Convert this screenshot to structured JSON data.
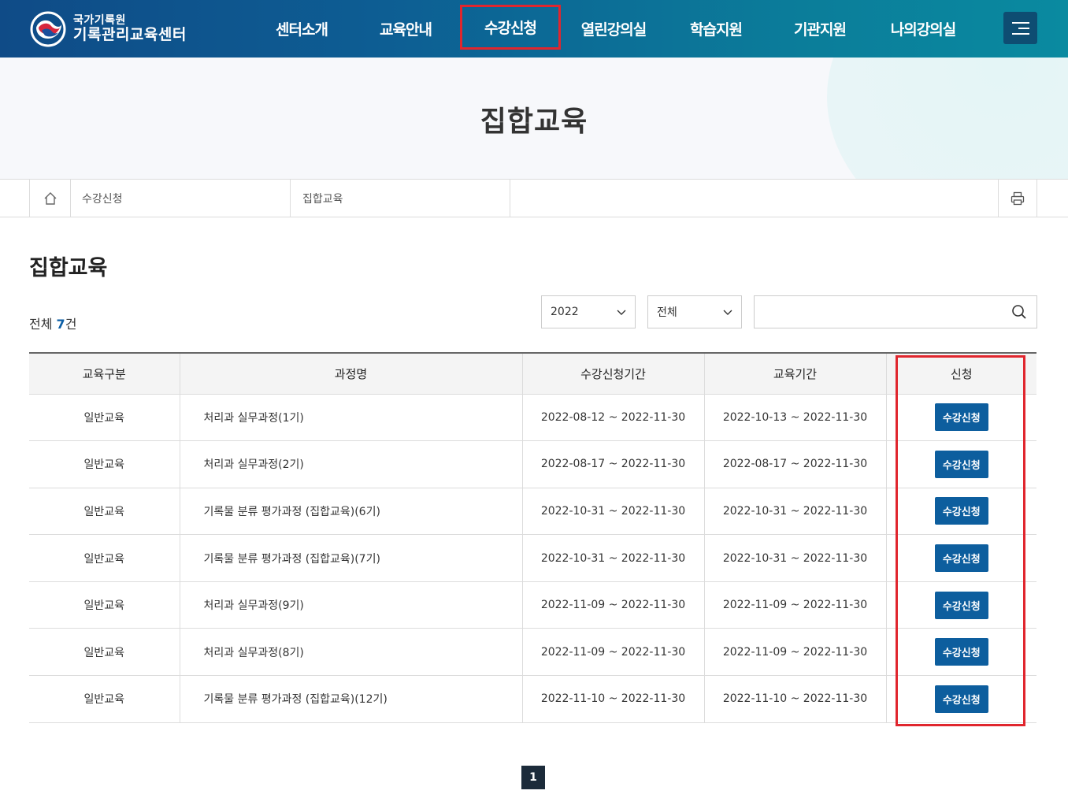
{
  "header": {
    "logo_line1": "국가기록원",
    "logo_line2": "기록관리교육센터",
    "nav": [
      "센터소개",
      "교육안내",
      "수강신청",
      "열린강의실",
      "학습지원",
      "기관지원",
      "나의강의실"
    ],
    "active_nav": "수강신청",
    "menu_icon": "hamburger-icon"
  },
  "visual": {
    "title": "집합교육"
  },
  "breadcrumb": {
    "home_icon": "home-icon",
    "level1": "수강신청",
    "level2": "집합교육",
    "print_icon": "printer-icon"
  },
  "main": {
    "heading": "집합교육",
    "total_prefix": "전체",
    "total_count": "7",
    "total_suffix": "건",
    "filters": {
      "year": "2022",
      "type": "전체",
      "search_placeholder": "",
      "search_icon": "search-icon"
    },
    "table": {
      "columns": [
        "교육구분",
        "과정명",
        "수강신청기간",
        "교육기간",
        "신청"
      ],
      "rows": [
        {
          "type": "일반교육",
          "course": "처리과 실무과정(1기)",
          "apply_period": "2022-08-12 ~ 2022-11-30",
          "edu_period": "2022-10-13 ~ 2022-11-30",
          "action": "수강신청"
        },
        {
          "type": "일반교육",
          "course": "처리과 실무과정(2기)",
          "apply_period": "2022-08-17 ~ 2022-11-30",
          "edu_period": "2022-08-17 ~ 2022-11-30",
          "action": "수강신청"
        },
        {
          "type": "일반교육",
          "course": "기록물 분류 평가과정 (집합교육)(6기)",
          "apply_period": "2022-10-31 ~ 2022-11-30",
          "edu_period": "2022-10-31 ~ 2022-11-30",
          "action": "수강신청"
        },
        {
          "type": "일반교육",
          "course": "기록물 분류 평가과정 (집합교육)(7기)",
          "apply_period": "2022-10-31 ~ 2022-11-30",
          "edu_period": "2022-10-31 ~ 2022-11-30",
          "action": "수강신청"
        },
        {
          "type": "일반교육",
          "course": "처리과 실무과정(9기)",
          "apply_period": "2022-11-09 ~ 2022-11-30",
          "edu_period": "2022-11-09 ~ 2022-11-30",
          "action": "수강신청"
        },
        {
          "type": "일반교육",
          "course": "처리과 실무과정(8기)",
          "apply_period": "2022-11-09 ~ 2022-11-30",
          "edu_period": "2022-11-09 ~ 2022-11-30",
          "action": "수강신청"
        },
        {
          "type": "일반교육",
          "course": "기록물 분류 평가과정 (집합교육)(12기)",
          "apply_period": "2022-11-10 ~ 2022-11-30",
          "edu_period": "2022-11-10 ~ 2022-11-30",
          "action": "수강신청"
        }
      ]
    },
    "pagination": {
      "current": "1"
    }
  },
  "colors": {
    "header_start": "#0f4b87",
    "header_end": "#0a8aa0",
    "accent": "#0d5e9e",
    "highlight": "#e0262e",
    "pager": "#1c2b3a"
  }
}
